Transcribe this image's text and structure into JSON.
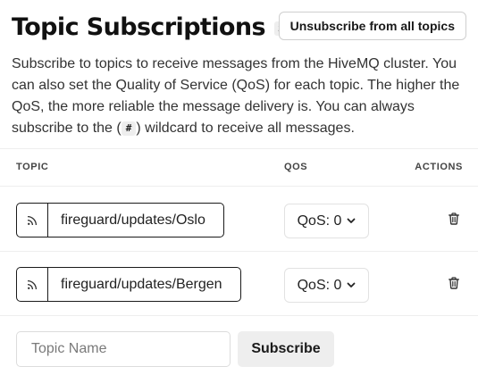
{
  "header": {
    "title": "Topic Subscriptions",
    "count": "2",
    "unsubscribe_all_label": "Unsubscribe from all topics"
  },
  "description": {
    "before_chip": "Subscribe to topics to receive messages from the HiveMQ cluster. You can also set the Quality of Service (QoS) for each topic. The higher the QoS, the more reliable the message delivery is. You can always subscribe to the (",
    "chip": "#",
    "after_chip": ") wildcard to receive all messages."
  },
  "table": {
    "columns": {
      "topic": "Topic",
      "qos": "QoS",
      "actions": "Actions"
    },
    "rows": [
      {
        "topic": "fireguard/updates/Oslo",
        "qos": "QoS: 0",
        "topic_icon": "rss-feed-icon",
        "delete_icon": "trash-icon"
      },
      {
        "topic": "fireguard/updates/Bergen",
        "qos": "QoS: 0",
        "topic_icon": "rss-feed-icon",
        "delete_icon": "trash-icon"
      }
    ]
  },
  "add_form": {
    "placeholder": "Topic Name",
    "value": "",
    "subscribe_label": "Subscribe"
  }
}
